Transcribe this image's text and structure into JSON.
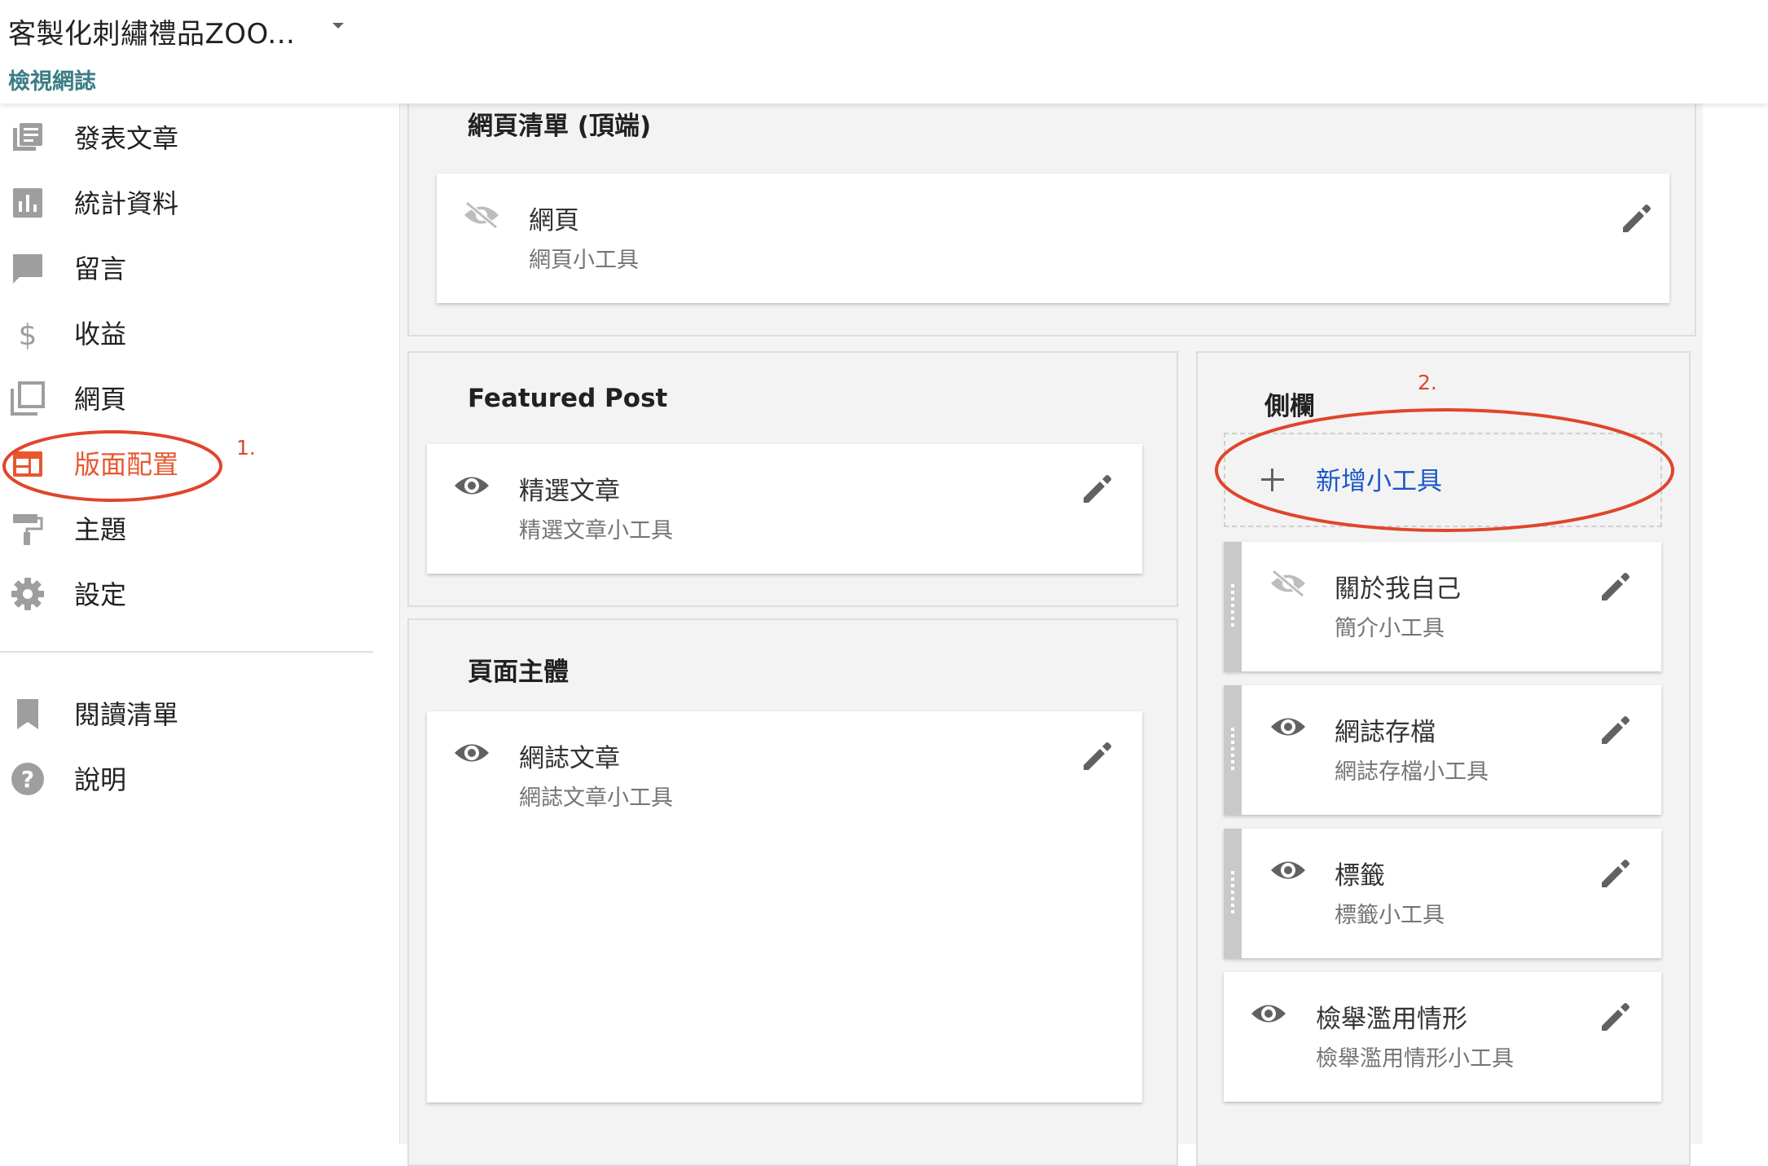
{
  "header": {
    "blog_title": "客製化刺繡禮品ZOO...",
    "view_blog": "檢視網誌"
  },
  "sidebar": {
    "items": [
      {
        "label": "發表文章",
        "icon": "posts-icon"
      },
      {
        "label": "統計資料",
        "icon": "stats-icon"
      },
      {
        "label": "留言",
        "icon": "comments-icon"
      },
      {
        "label": "收益",
        "icon": "dollar-icon"
      },
      {
        "label": "網頁",
        "icon": "pages-icon"
      },
      {
        "label": "版面配置",
        "icon": "layout-icon",
        "active": true
      },
      {
        "label": "主題",
        "icon": "theme-roller-icon"
      },
      {
        "label": "設定",
        "icon": "gear-icon"
      }
    ],
    "secondary": [
      {
        "label": "閱讀清單",
        "icon": "bookmark-icon"
      },
      {
        "label": "說明",
        "icon": "help-icon"
      }
    ]
  },
  "annotations": {
    "one": "1.",
    "two": "2."
  },
  "layout": {
    "top_section": {
      "title": "網頁清單 (頂端)",
      "widgets": [
        {
          "name": "網頁",
          "type": "網頁小工具",
          "visible": false
        }
      ]
    },
    "featured_section": {
      "title": "Featured Post",
      "widgets": [
        {
          "name": "精選文章",
          "type": "精選文章小工具",
          "visible": true
        }
      ]
    },
    "body_section": {
      "title": "頁面主體",
      "widgets": [
        {
          "name": "網誌文章",
          "type": "網誌文章小工具",
          "visible": true
        }
      ]
    },
    "sidebar_section": {
      "title": "側欄",
      "add_widget": "新增小工具",
      "widgets": [
        {
          "name": "關於我自己",
          "type": "簡介小工具",
          "visible": false
        },
        {
          "name": "網誌存檔",
          "type": "網誌存檔小工具",
          "visible": true
        },
        {
          "name": "標籤",
          "type": "標籤小工具",
          "visible": true
        },
        {
          "name": "檢舉濫用情形",
          "type": "檢舉濫用情形小工具",
          "visible": true
        }
      ]
    }
  },
  "colors": {
    "accent_active": "#e8572f",
    "annotation_red": "#e0452b",
    "link_teal": "#3b7d86",
    "add_widget_blue": "#1a56c8"
  }
}
